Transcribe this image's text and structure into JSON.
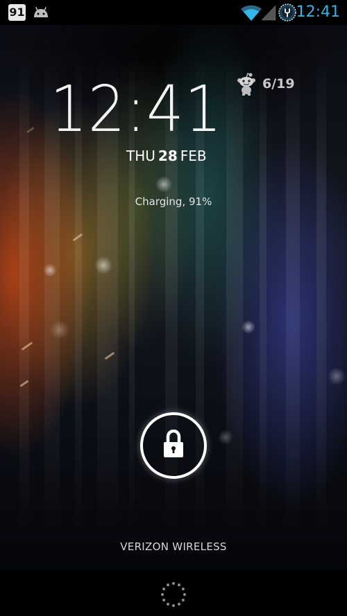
{
  "status_bar": {
    "badge_text": "91",
    "time": "12:41",
    "time_color": "#33b5e5",
    "icons": [
      "android-icon",
      "wifi-icon",
      "signal-icon",
      "usb-debug-icon"
    ]
  },
  "lock_screen": {
    "clock": "12:41",
    "date": {
      "weekday": "THU",
      "day": "28",
      "month": "FEB"
    },
    "widget": {
      "icon": "reddit-alien-icon",
      "count": "6/19"
    },
    "charging_status": "Charging, 91%",
    "unlock_icon": "padlock-icon",
    "carrier": "VERIZON WIRELESS"
  },
  "nav_bar": {
    "icon": "loading-spinner-icon"
  }
}
